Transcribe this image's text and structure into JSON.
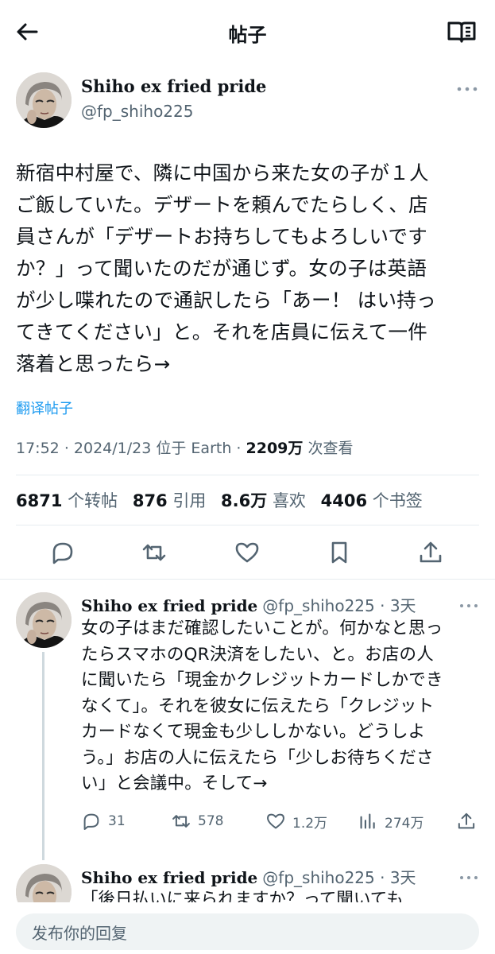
{
  "header": {
    "title": "帖子",
    "back_icon": "arrow-left-icon",
    "reader_icon": "book-open-icon"
  },
  "tweet": {
    "author_name": "Shiho ex fried pride",
    "author_handle": "@fp_shiho225",
    "text_lines": [
      "新宿中村屋で、隣に中国から来た女の子が１人",
      "ご飯していた。デザートを頼んでたらしく、店",
      "員さんが「デザートお持ちしてもよろしいです",
      "か？」って聞いたのだが通じず。女の子は英語",
      "が少し喋れたので通訳したら「あー！ はい持っ",
      "てきてください」と。それを店員に伝えて一件",
      "落着と思ったら→"
    ],
    "translate_label": "翻译帖子",
    "time": "17:52",
    "date": "2024/1/23",
    "location_prefix": "位于 Earth",
    "views_value": "2209万",
    "views_label": "次查看",
    "stats": [
      {
        "value": "6871",
        "label": "个转帖"
      },
      {
        "value": "876",
        "label": "引用"
      },
      {
        "value": "8.6万",
        "label": "喜欢"
      },
      {
        "value": "4406",
        "label": "个书签"
      }
    ]
  },
  "replies": [
    {
      "author_name": "Shiho ex fried pride",
      "handle_time": "@fp_shiho225 · 3天",
      "text_lines": [
        "女の子はまだ確認したいことが。何かなと思っ",
        "たらスマホのQR決済をしたい、と。お店の人",
        "に聞いたら「現金かクレジットカードしかでき",
        "なくて」。それを彼女に伝えたら「クレジット",
        "カードなくて現金も少ししかない。どうしよ",
        "う。」お店の人に伝えたら「少しお待ちくださ",
        "い」と会議中。そして→"
      ],
      "replies": "31",
      "retweets": "578",
      "likes": "1.2万",
      "views": "274万"
    },
    {
      "author_name": "Shiho ex fried pride",
      "handle_time": "@fp_shiho225 · 3天",
      "text_lines": [
        "「後日払いに来られますか？って聞いても"
      ]
    }
  ],
  "compose": {
    "placeholder": "发布你的回复"
  }
}
